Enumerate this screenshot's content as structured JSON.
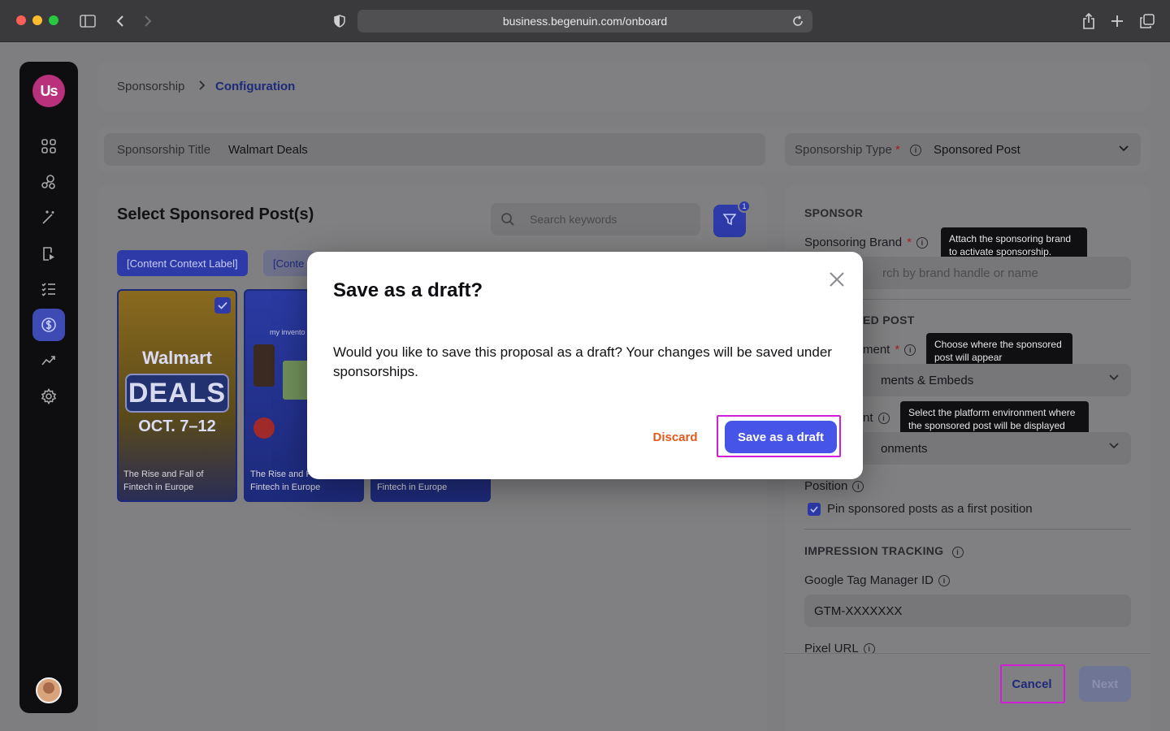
{
  "browser": {
    "url": "business.begenuin.com/onboard"
  },
  "sidebar": {
    "logo_text": "Us",
    "items": [
      {
        "icon": "grid-icon"
      },
      {
        "icon": "community-icon"
      },
      {
        "icon": "magic-wand-icon"
      },
      {
        "icon": "video-page-icon"
      },
      {
        "icon": "checklist-icon"
      },
      {
        "icon": "dollar-icon",
        "active": true
      },
      {
        "icon": "analytics-icon"
      },
      {
        "icon": "settings-icon"
      }
    ]
  },
  "breadcrumb": {
    "parent": "Sponsorship",
    "current": "Configuration"
  },
  "form": {
    "title_label": "Sponsorship Title",
    "title_value": "Walmart Deals",
    "type_label": "Sponsorship Type",
    "type_required": "*",
    "type_value": "Sponsored Post"
  },
  "posts": {
    "heading": "Select Sponsored Post(s)",
    "search_placeholder": "Search keywords",
    "filter_count": "1",
    "chips": [
      "[Content Context Label]",
      "[Conte"
    ],
    "thumbs": [
      {
        "caption": "The Rise and Fall of Fintech in Europe",
        "brand": "Walmart",
        "headline": "DEALS",
        "date": "OCT. 7–12",
        "checked": true
      },
      {
        "caption": "The Rise and Fall of Fintech in Europe",
        "label": "my invento"
      },
      {
        "caption": "Fintech in Europe"
      }
    ]
  },
  "sponsor": {
    "section": "SPONSOR",
    "brand_label": "Sponsoring Brand",
    "brand_required": "*",
    "brand_tooltip": "Attach the sponsoring brand to activate sponsorship.",
    "brand_placeholder": "rch by brand handle or name",
    "post_section": "ED POST",
    "placement_label": "ment",
    "placement_required": "*",
    "placement_tooltip": "Choose where the sponsored post will appear",
    "placement_value": "ments & Embeds",
    "env_label": "nt",
    "env_tooltip": "Select the platform environment where the sponsored post will be displayed",
    "env_value": "onments",
    "position_label": "Position",
    "pin_label": "Pin sponsored posts as a first position",
    "impression_section": "IMPRESSION TRACKING",
    "gtm_label": "Google Tag Manager ID",
    "gtm_value": "GTM-XXXXXXX",
    "pixel_label": "Pixel URL"
  },
  "footer": {
    "cancel": "Cancel",
    "next": "Next"
  },
  "modal": {
    "title": "Save as a draft?",
    "body": "Would you like to save this proposal as a draft? Your changes will be saved under sponsorships.",
    "discard": "Discard",
    "save": "Save as a draft"
  },
  "colors": {
    "accent": "#4654e8",
    "discard": "#e05a1e",
    "highlight": "#d21fd7"
  }
}
